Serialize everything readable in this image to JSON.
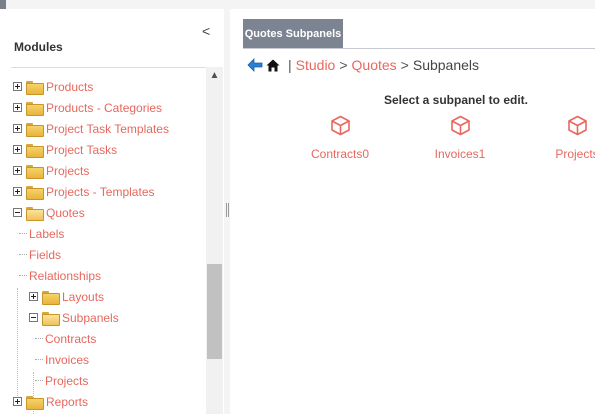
{
  "modules_panel": {
    "title": "Modules",
    "collapse_glyph": "<",
    "scroll_up_glyph": "▲",
    "tree": [
      {
        "label": "Products",
        "expander": "plus"
      },
      {
        "label": "Products - Categories",
        "expander": "plus"
      },
      {
        "label": "Project Task Templates",
        "expander": "plus"
      },
      {
        "label": "Project Tasks",
        "expander": "plus"
      },
      {
        "label": "Projects",
        "expander": "plus"
      },
      {
        "label": "Projects - Templates",
        "expander": "plus"
      },
      {
        "label": "Quotes",
        "expander": "minus"
      },
      {
        "label": "Labels"
      },
      {
        "label": "Fields"
      },
      {
        "label": "Relationships"
      },
      {
        "label": "Layouts",
        "expander": "plus"
      },
      {
        "label": "Subpanels",
        "expander": "minus"
      },
      {
        "label": "Contracts"
      },
      {
        "label": "Invoices"
      },
      {
        "label": "Projects"
      },
      {
        "label": "Reports",
        "expander": "plus"
      }
    ]
  },
  "right_panel": {
    "tab_label": "Quotes Subpanels",
    "breadcrumb": {
      "separator": "|",
      "studio": "Studio",
      "arrow1": ">",
      "module": "Quotes",
      "arrow2": ">",
      "current": "Subpanels"
    },
    "instruction": "Select a subpanel to edit.",
    "subpanels": [
      {
        "label": "Contracts0",
        "icon": "cube-icon"
      },
      {
        "label": "Invoices1",
        "icon": "cube-icon"
      },
      {
        "label": "Projects",
        "icon": "cube-icon"
      }
    ]
  },
  "colors": {
    "link": "#e7685e",
    "tab_bg": "#7c8391",
    "folder": "#f6d36b",
    "back_arrow": "#2a7fd4"
  }
}
